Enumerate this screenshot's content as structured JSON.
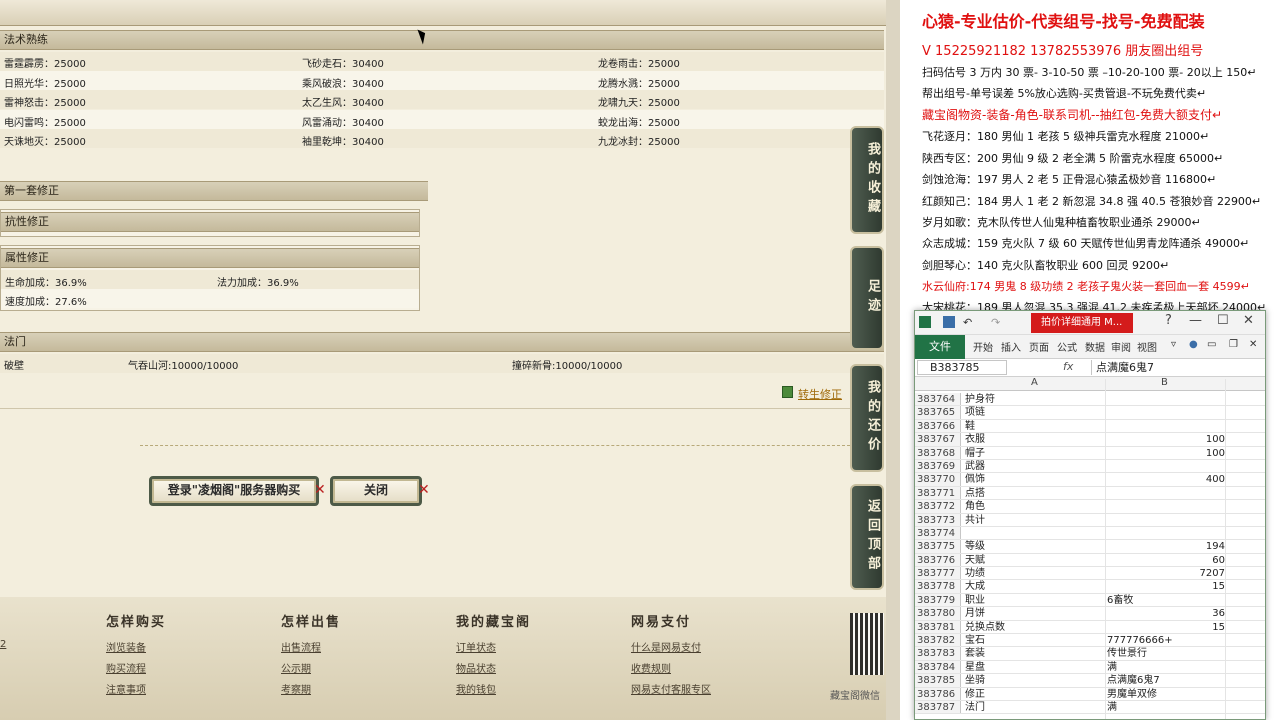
{
  "spells": {
    "title": "法术熟练",
    "rows": [
      [
        "雷霆霹雳：25000",
        "飞砂走石：30400",
        "龙卷雨击：25000"
      ],
      [
        "日照光华：25000",
        "乘风破浪：30400",
        "龙腾水溅：25000"
      ],
      [
        "雷神怒击：25000",
        "太乙生风：30400",
        "龙啸九天：25000"
      ],
      [
        "电闪雷鸣：25000",
        "风雷涌动：30400",
        "蛟龙出海：25000"
      ],
      [
        "天诛地灭：25000",
        "袖里乾坤：30400",
        "九龙冰封：25000"
      ]
    ]
  },
  "fix": {
    "title": "第一套修正",
    "resist_title": "抗性修正",
    "attr_title": "属性修正",
    "hp": "生命加成：36.9%",
    "mp": "法力加成：36.9%",
    "speed": "速度加成：27.6%"
  },
  "sect": {
    "title": "法门",
    "c1": "破壁",
    "c2": "气吞山河:10000/10000",
    "c3": "撞碎新骨:10000/10000"
  },
  "rebirth_link": "转生修正",
  "buttons": {
    "login_buy": "登录\"凌烟阁\"服务器购买",
    "close": "关闭"
  },
  "sidebar": [
    "我的收藏",
    "足迹",
    "我的还价",
    "返回顶部"
  ],
  "footer": {
    "cols": [
      {
        "title": "怎样购买",
        "links": [
          "浏览装备",
          "购买流程",
          "注意事项"
        ]
      },
      {
        "title": "怎样出售",
        "links": [
          "出售流程",
          "公示期",
          "考察期"
        ]
      },
      {
        "title": "我的藏宝阁",
        "links": [
          "订单状态",
          "物品状态",
          "我的钱包"
        ]
      },
      {
        "title": "网易支付",
        "links": [
          "什么是网易支付",
          "收费规则",
          "网易支付客服专区"
        ]
      }
    ],
    "left_link": "2",
    "brand": "藏宝阁微信"
  },
  "notes": {
    "headline": "心猿-专业估价-代卖组号-找号-免费配装",
    "phones": "V 15225921182   13782553976 朋友圈出组号",
    "lines": [
      {
        "text": "扫码估号 3 万内 30 票- 3-10-50 票  –10-20-100 票- 20以上 150↵",
        "red": false
      },
      {
        "text": "帮出组号-单号误差 5%放心选购-买贵管退-不玩免费代卖↵",
        "red": false
      },
      {
        "text": "藏宝阁物资-装备-角色-联系司机--抽红包-免费大额支付↵",
        "red": true
      },
      {
        "text": "飞花逐月：180 男仙 1 老孩 5 级神兵雷克水程度 21000↵",
        "red": false
      },
      {
        "text": "陕西专区：200 男仙 9 级 2 老全满 5 阶雷克水程度 65000↵",
        "red": false
      },
      {
        "text": "剑蚀沧海：197 男人 2 老 5 正骨混心猿孟极妙音 116800↵",
        "red": false
      },
      {
        "text": "红颜知己：184 男人 1 老 2 新忽混 34.8 强 40.5 苍狼妙音 22900↵",
        "red": false
      },
      {
        "text": "岁月如歌：克木队传世人仙鬼种植畜牧职业通杀 29000↵",
        "red": false
      },
      {
        "text": "众志成城：159 克火队 7 级 60 天赋传世仙男青龙阵通杀 49000↵",
        "red": false
      },
      {
        "text": "剑胆琴心：140 克火队畜牧职业 600 回灵 9200↵",
        "red": false
      },
      {
        "text": "水云仙府:174 男鬼 8 级功绩 2 老孩子鬼火装一套回血一套 4599↵",
        "red": true
      },
      {
        "text": "大宋桃花：189 男人忽混 35.3 强混 41.2 未疾孟极上天部坏 24000↵",
        "red": false
      }
    ]
  },
  "excel": {
    "title_tag": "拍价详细通用 M...",
    "ribbon": [
      "文件",
      "开始",
      "插入",
      "页面",
      "公式",
      "数据",
      "审阅",
      "视图"
    ],
    "namebox": "B383785",
    "fx": "fx",
    "formula": "点满魔6鬼7",
    "col_a": "A",
    "col_b": "B",
    "rows": [
      [
        "383764",
        "护身符",
        ""
      ],
      [
        "383765",
        "项链",
        ""
      ],
      [
        "383766",
        "鞋",
        ""
      ],
      [
        "383767",
        "衣服",
        "100"
      ],
      [
        "383768",
        "帽子",
        "100"
      ],
      [
        "383769",
        "武器",
        ""
      ],
      [
        "383770",
        "佩饰",
        "400"
      ],
      [
        "383771",
        "点搭",
        ""
      ],
      [
        "383772",
        "角色",
        ""
      ],
      [
        "383773",
        "共计",
        ""
      ],
      [
        "383774",
        "",
        ""
      ],
      [
        "383775",
        "等级",
        "194"
      ],
      [
        "383776",
        "天赋",
        "60"
      ],
      [
        "383777",
        "功绩",
        "7207"
      ],
      [
        "383778",
        "大成",
        "15"
      ],
      [
        "383779",
        "职业",
        "6畜牧"
      ],
      [
        "383780",
        "月饼",
        "36"
      ],
      [
        "383781",
        "兑换点数",
        "15"
      ],
      [
        "383782",
        "宝石",
        "777776666+"
      ],
      [
        "383783",
        "套装",
        "传世景行"
      ],
      [
        "383784",
        "星盘",
        "满"
      ],
      [
        "383785",
        "坐骑",
        "点满魔6鬼7"
      ],
      [
        "383786",
        "修正",
        "男魔单双修"
      ],
      [
        "383787",
        "法门",
        "满"
      ]
    ]
  }
}
